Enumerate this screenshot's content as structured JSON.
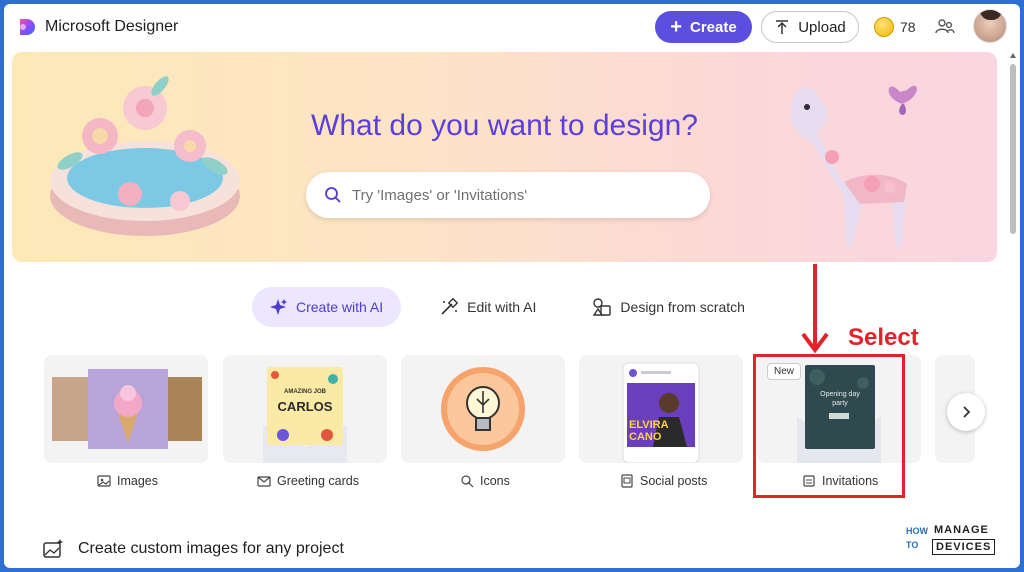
{
  "app": {
    "title": "Microsoft Designer"
  },
  "header": {
    "create_label": "Create",
    "upload_label": "Upload",
    "coins": "78"
  },
  "hero": {
    "title": "What do you want to design?",
    "search_placeholder": "Try 'Images' or 'Invitations'",
    "search_value": ""
  },
  "modes": [
    {
      "label": "Create with AI",
      "icon": "sparkle-icon",
      "active": true
    },
    {
      "label": "Edit with AI",
      "icon": "magic-wand-icon",
      "active": false
    },
    {
      "label": "Design from scratch",
      "icon": "shapes-icon",
      "active": false
    }
  ],
  "categories": [
    {
      "label": "Images",
      "icon": "image-icon"
    },
    {
      "label": "Greeting cards",
      "icon": "envelope-icon"
    },
    {
      "label": "Icons",
      "icon": "icon-shapes-icon"
    },
    {
      "label": "Social posts",
      "icon": "social-post-icon"
    },
    {
      "label": "Invitations",
      "icon": "invitation-icon",
      "badge": "New"
    }
  ],
  "card_art": {
    "greeting_top": "AMAZING JOB",
    "greeting_name": "CARLOS",
    "social_name_1": "ELVIRA",
    "social_name_2": "CANO",
    "invite_line_1": "Opening day",
    "invite_line_2": "party"
  },
  "annotation": {
    "text": "Select",
    "color": "#e5222a"
  },
  "bottom": {
    "text": "Create custom images for any project"
  },
  "watermark": {
    "how": "HOW",
    "to": "TO",
    "manage": "MANAGE",
    "devices": "DEVICES"
  },
  "colors": {
    "accent": "#5b4fe0",
    "hero_title": "#5b3fd9",
    "active_tab_bg": "#ece6ff"
  }
}
